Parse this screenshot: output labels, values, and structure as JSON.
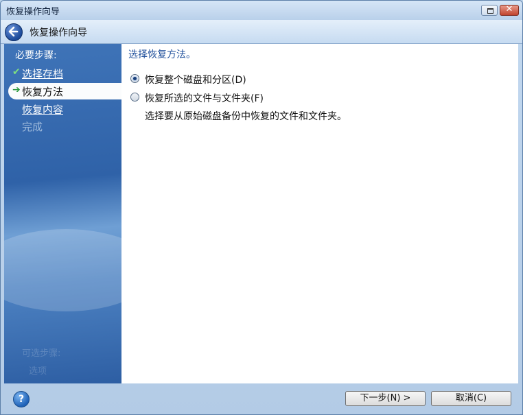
{
  "window": {
    "title": "恢复操作向导"
  },
  "header": {
    "title": "恢复操作向导"
  },
  "sidebar": {
    "title": "必要步骤:",
    "steps": [
      {
        "label": "选择存档",
        "state": "done",
        "icon": "check-icon"
      },
      {
        "label": "恢复方法",
        "state": "active",
        "icon": "arrow-right-icon"
      },
      {
        "label": "恢复内容",
        "state": "link"
      },
      {
        "label": "完成",
        "state": "disabled"
      }
    ],
    "faded_lines": [
      "可选步骤:",
      "选项"
    ]
  },
  "content": {
    "title": "选择恢复方法。",
    "options": [
      {
        "label": "恢复整个磁盘和分区(D)",
        "checked": true
      },
      {
        "label": "恢复所选的文件与文件夹(F)",
        "checked": false
      }
    ],
    "description": "选择要从原始磁盘备份中恢复的文件和文件夹。"
  },
  "footer": {
    "next_label": "下一步(N) >",
    "cancel_label": "取消(C)",
    "help_glyph": "?"
  }
}
